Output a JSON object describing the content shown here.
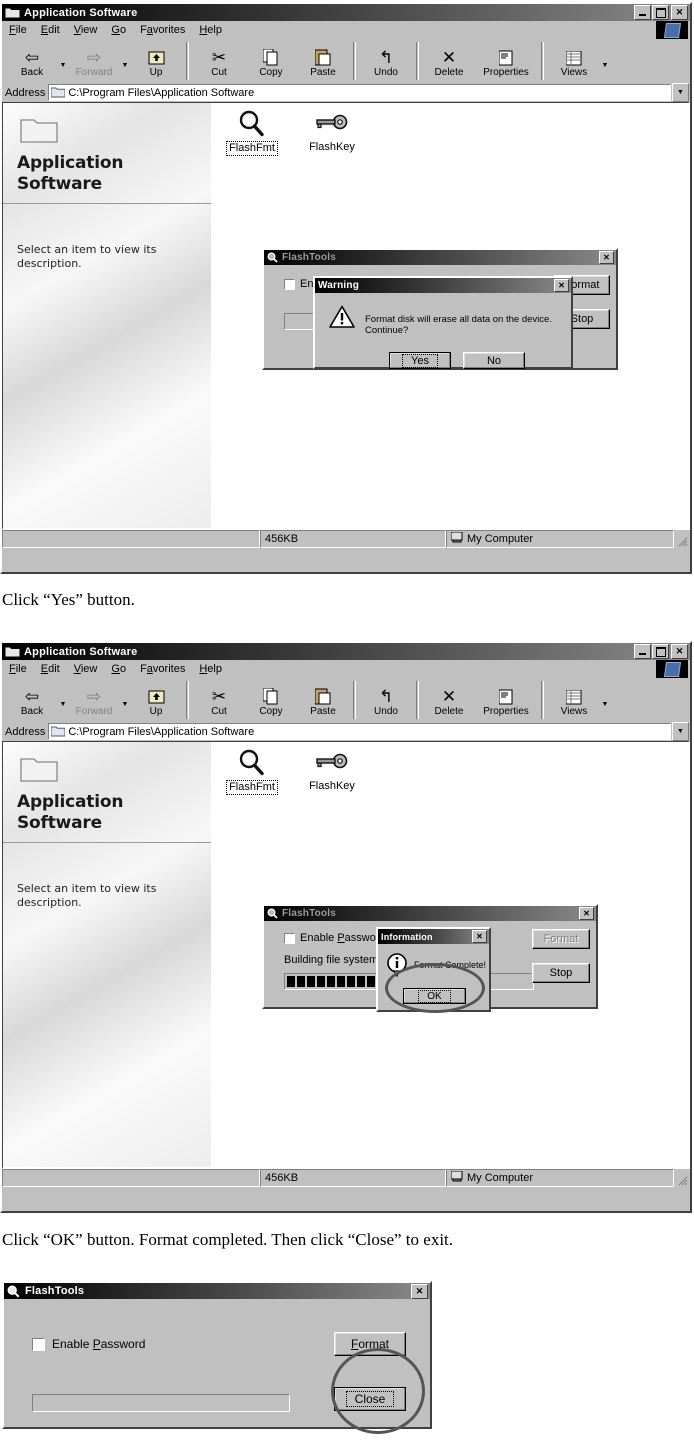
{
  "explorer": {
    "title": "Application Software",
    "titlebar_buttons": [
      "minimize",
      "maximize",
      "close"
    ],
    "menu": [
      {
        "label": "File",
        "accel": "F"
      },
      {
        "label": "Edit",
        "accel": "E"
      },
      {
        "label": "View",
        "accel": "V"
      },
      {
        "label": "Go",
        "accel": "G"
      },
      {
        "label": "Favorites",
        "accel": "a"
      },
      {
        "label": "Help",
        "accel": "H"
      }
    ],
    "toolbar": [
      {
        "label": "Back",
        "icon": "back-arrow-icon",
        "disabled": false,
        "caret": true
      },
      {
        "label": "Forward",
        "icon": "forward-arrow-icon",
        "disabled": true,
        "caret": true
      },
      {
        "label": "Up",
        "icon": "up-folder-icon",
        "disabled": false,
        "caret": false
      },
      {
        "label": "Cut",
        "icon": "scissors-icon",
        "disabled": false,
        "caret": false
      },
      {
        "label": "Copy",
        "icon": "copy-icon",
        "disabled": false,
        "caret": false
      },
      {
        "label": "Paste",
        "icon": "paste-icon",
        "disabled": false,
        "caret": false
      },
      {
        "label": "Undo",
        "icon": "undo-icon",
        "disabled": false,
        "caret": false
      },
      {
        "label": "Delete",
        "icon": "delete-x-icon",
        "disabled": false,
        "caret": false
      },
      {
        "label": "Properties",
        "icon": "properties-icon",
        "disabled": false,
        "caret": false
      },
      {
        "label": "Views",
        "icon": "views-icon",
        "disabled": false,
        "caret": true
      }
    ],
    "address": {
      "label": "Address",
      "value": "C:\\Program Files\\Application Software"
    },
    "left_pane": {
      "heading": "Application Software",
      "description": "Select an item to view its description."
    },
    "icons": [
      {
        "label": "FlashFmt",
        "glyph": "magnifier-icon",
        "selected": true
      },
      {
        "label": "FlashKey",
        "glyph": "key-icon",
        "selected": false
      }
    ],
    "status": {
      "left": "",
      "size": "456KB",
      "zone": "My Computer"
    }
  },
  "flashtools": {
    "title": "FlashTools",
    "enable_password": {
      "label_pre": "Enable ",
      "accel": "P",
      "label_post": "assword"
    },
    "format_button": "Format",
    "stop_button": "Stop",
    "close_button": "Close",
    "building_text": "Building file system.."
  },
  "warning_dialog": {
    "title": "Warning",
    "message": "Format disk will erase all data on the device. Continue?",
    "yes_button": "Yes",
    "no_button": "No",
    "icon": "warning-triangle-icon"
  },
  "information_dialog": {
    "title": "Information",
    "message": "Format Complete!",
    "ok_button": "OK",
    "icon": "info-circle-icon"
  },
  "captions": {
    "first": "Click “Yes” button.",
    "second": "Click “OK” button. Format completed. Then click “Close” to exit."
  },
  "colors": {
    "window_face": "#c0c0c0",
    "title_active_start": "#000000",
    "title_active_end": "#8a8a8a",
    "text": "#000000",
    "disabled_text": "#808080",
    "highlight_circle": "#555555"
  }
}
